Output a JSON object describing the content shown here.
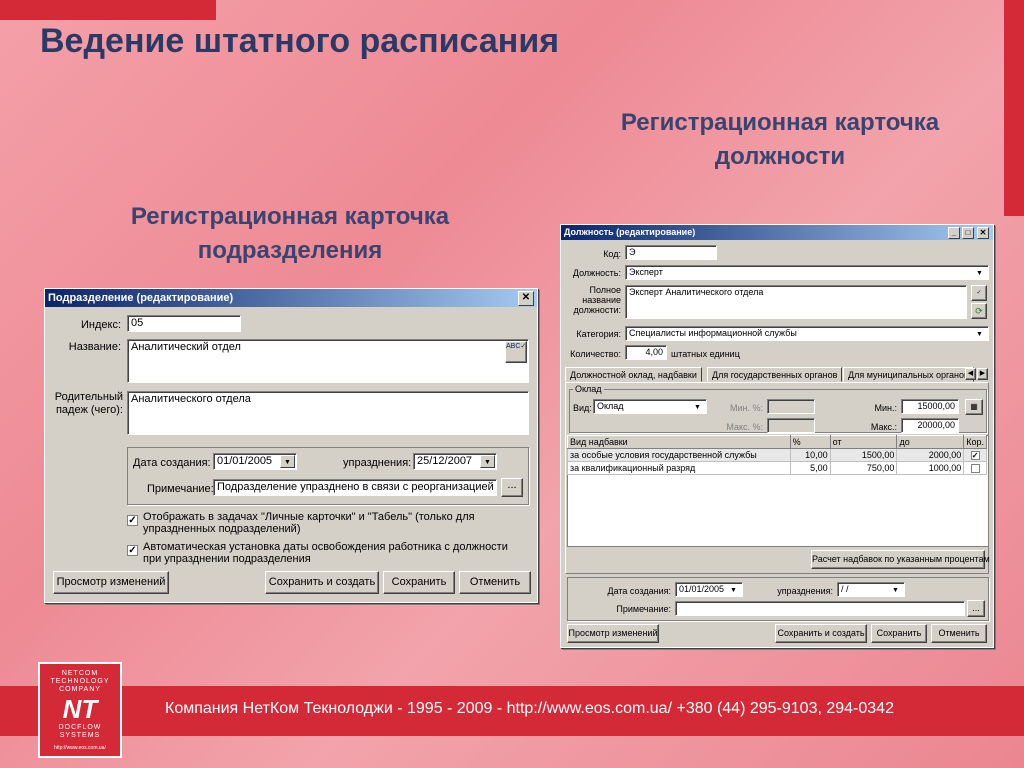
{
  "slide": {
    "title": "Ведение штатного расписания",
    "caption_position": "Регистрационная карточка должности",
    "caption_division": "Регистрационная карточка подразделения",
    "footer": "Компания НетКом Текнолоджи - 1995 - 2009 - http://www.eos.com.ua/ +380 (44) 295-9103, 294-0342",
    "logo": {
      "top": "NETCOM TECHNOLOGY COMPANY",
      "mark": "NT",
      "bottom": "DOCFLOW SYSTEMS",
      "url": "http://www.eos.com.ua/"
    }
  },
  "division": {
    "title": "Подразделение (редактирование)",
    "close": "✕",
    "index_label": "Индекс:",
    "index_value": "05",
    "name_label": "Название:",
    "name_value": "Аналитический отдел",
    "parent_label": "Родительный падеж (чего):",
    "parent_value": "Аналитического отдела",
    "created_label": "Дата создания:",
    "created_value": "01/01/2005",
    "abolished_label": "упразднения:",
    "abolished_value": "25/12/2007",
    "note_label": "Примечание:",
    "note_value": "Подразделение упразднено в связи с реорганизацией",
    "chk1": "Отображать в задачах \"Личные карточки\" и \"Табель\" (только для упраздненных подразделений)",
    "chk2": "Автоматическая установка даты освобождения работника с должности при упразднении подразделения",
    "btn_history": "Просмотр изменений",
    "btn_save_create": "Сохранить и создать",
    "btn_save": "Сохранить",
    "btn_cancel": "Отменить",
    "ellipsis": "..."
  },
  "position": {
    "title": "Должность (редактирование)",
    "code_label": "Код:",
    "code_value": "Э",
    "pos_label": "Должность:",
    "pos_value": "Эксперт",
    "full_label": "Полное название должности:",
    "full_value": "Эксперт  Аналитического отдела",
    "cat_label": "Категория:",
    "cat_value": "Специалисты информационной службы",
    "qty_label": "Количество:",
    "qty_value": "4,00",
    "qty_unit": "штатных единиц",
    "tabs": [
      "Должностной оклад, надбавки",
      "Для государственных органов",
      "Для муниципальных органов"
    ],
    "salary_group": "Оклад",
    "type_label": "Вид:",
    "type_value": "Оклад",
    "minpct_label": "Мин. %:",
    "maxpct_label": "Макс. %:",
    "min_label": "Мин.:",
    "min_value": "15000,00",
    "max_label": "Макс.:",
    "max_value": "20000,00",
    "table_headers": [
      "Вид надбавки",
      "%",
      "от",
      "до",
      "Кор."
    ],
    "rows": [
      {
        "name": "за особые условия государственной службы",
        "pct": "10,00",
        "from": "1500,00",
        "to": "2000,00",
        "cor": "✓"
      },
      {
        "name": "за квалификационный разряд",
        "pct": "5,00",
        "from": "750,00",
        "to": "1000,00",
        "cor": ""
      }
    ],
    "calc_btn": "Расчет надбавок по указанным процентам",
    "created_label": "Дата создания:",
    "created_value": "01/01/2005",
    "abolished_label": "упразднения:",
    "abolished_value": " / /",
    "note_label": "Примечание:",
    "note_value": "",
    "btn_history": "Просмотр изменений",
    "btn_save_create": "Сохранить и создать",
    "btn_save": "Сохранить",
    "btn_cancel": "Отменить",
    "ellipsis": "...",
    "winctl": {
      "min": "_",
      "max": "□",
      "close": "✕"
    }
  }
}
